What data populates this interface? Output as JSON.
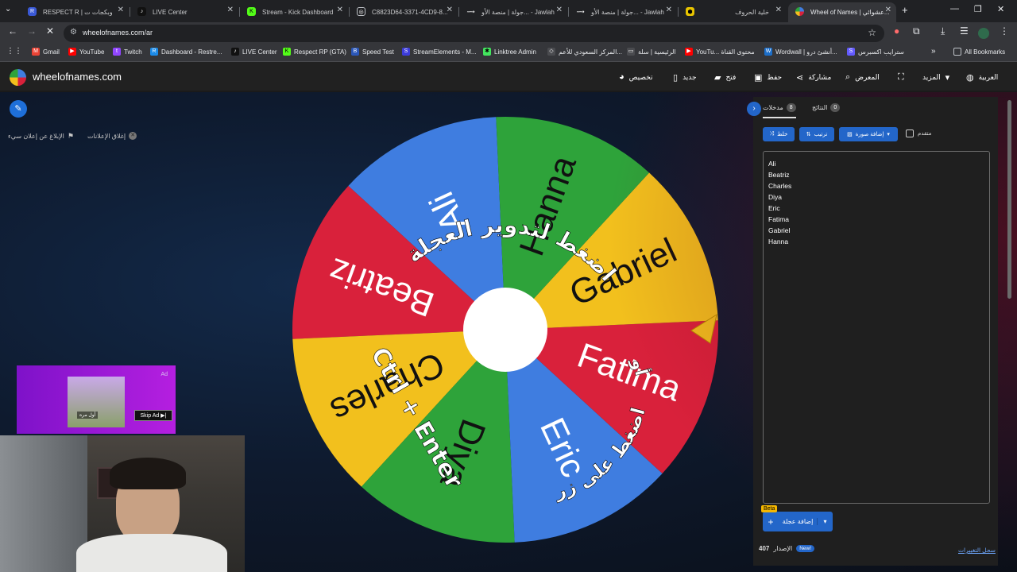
{
  "browser": {
    "tabs": [
      {
        "label": "RESPECT R | وبكجات ت",
        "favicon": "R",
        "active": false
      },
      {
        "label": "LIVE Center",
        "favicon": "tiktok-icon",
        "active": false
      },
      {
        "label": "Stream - Kick Dashboard",
        "favicon": "K",
        "active": false
      },
      {
        "label": "C8823D64-3371-4CD9-8...",
        "favicon": "link-icon",
        "active": false
      },
      {
        "label": "جولة | منصة الأو... - Jawlah",
        "favicon": "jawlah-icon",
        "active": false
      },
      {
        "label": "جولة | منصة الأو... - Jawlah",
        "favicon": "jawlah-icon",
        "active": false
      },
      {
        "label": "خلية الحروف",
        "favicon": "hex-icon",
        "active": false
      },
      {
        "label": "Wheel of Names | عشوائي...",
        "favicon": "wheel-icon",
        "active": true
      }
    ],
    "url": "wheelofnames.com/ar",
    "bookmarks": [
      "Gmail",
      "YouTube",
      "Twitch",
      "Dashboard - Restre...",
      "LIVE Center",
      "Respect RP (GTA)",
      "Speed Test",
      "StreamElements - M...",
      "Linktree Admin",
      "المركز السعودي للأعم...",
      "الرئيسية | سلة",
      "YouTu... محتوى القناة",
      "Wordwall | أنشئ درو...",
      "سترايب اكسبرس"
    ],
    "all_bookmarks": "All Bookmarks"
  },
  "site": {
    "name": "wheelofnames.com",
    "nav": {
      "customize": "تخصيص",
      "new": "جديد",
      "open": "فتح",
      "save": "حفظ",
      "share": "مشاركة",
      "gallery": "المعرض",
      "more": "المزيد",
      "language": "العربية"
    },
    "ads_close": "إغلاق الإعلانات",
    "ads_report": "الإبلاغ عن إعلان سيء"
  },
  "wheel": {
    "segments": [
      {
        "name": "Ali",
        "color": "#3f7de0"
      },
      {
        "name": "Beatriz",
        "color": "#d9213b"
      },
      {
        "name": "Charles",
        "color": "#f2c01d"
      },
      {
        "name": "Diya",
        "color": "#2ea33a"
      },
      {
        "name": "Eric",
        "color": "#3f7de0"
      },
      {
        "name": "Fatima",
        "color": "#d9213b"
      },
      {
        "name": "Gabriel",
        "color": "#f2c01d"
      },
      {
        "name": "Hanna",
        "color": "#2ea33a"
      }
    ],
    "instruction_top": "اضغط لتدوير العجلة",
    "instruction_or": "أو",
    "instruction_bottom": "اضغط على زر",
    "instruction_ctrl": "Ctrl + Enter",
    "pointer_color": "#f2c01d"
  },
  "panel": {
    "tab_entries": "مدخلات",
    "entries_count": "8",
    "tab_results": "النتائج",
    "results_count": "0",
    "shuffle": "خلط",
    "sort": "ترتيب",
    "add_image": "إضافة صورة",
    "advanced": "متقدم",
    "entries": [
      "Ali",
      "Beatriz",
      "Charles",
      "Diya",
      "Eric",
      "Fatima",
      "Gabriel",
      "Hanna"
    ],
    "beta": "Beta",
    "add_wheel": "إضافة عجلة",
    "version_label": "الإصدار",
    "version": "407",
    "new_badge": "New!",
    "changelog": "سجل التغييرات"
  },
  "ad": {
    "label": "Ad",
    "skip": "Skip Ad",
    "caption": "أول مره"
  }
}
